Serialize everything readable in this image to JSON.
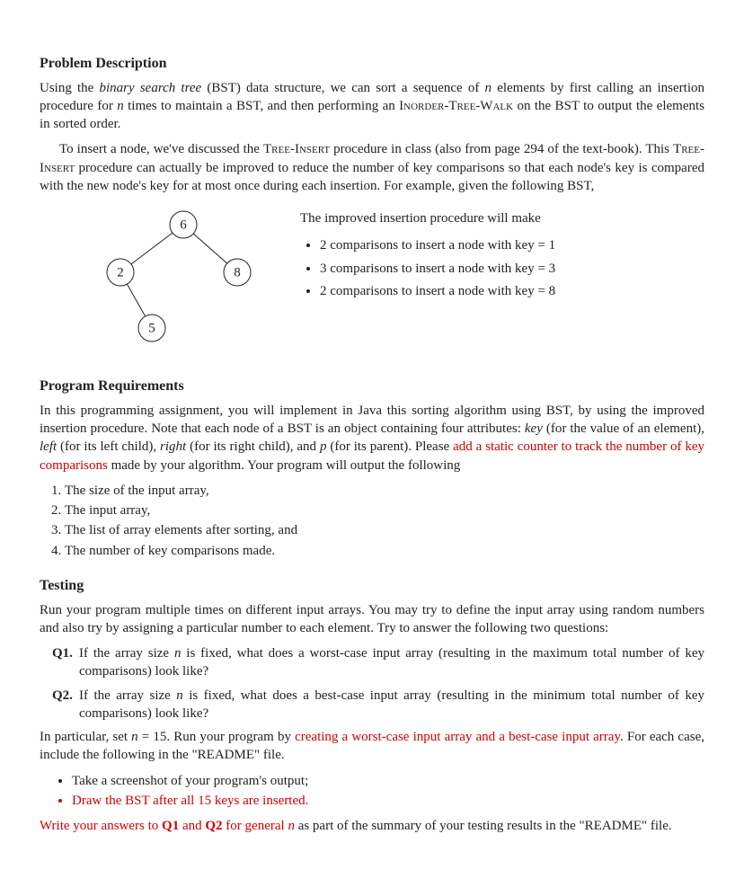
{
  "sections": {
    "desc_title": "Problem Description",
    "reqs_title": "Program Requirements",
    "testing_title": "Testing"
  },
  "desc": {
    "p1_a": "Using the ",
    "p1_b": "binary search tree",
    "p1_c": " (BST) data structure, we can sort a sequence of ",
    "p1_n": "n",
    "p1_d": " elements by first calling an insertion procedure for ",
    "p1_n2": "n",
    "p1_e": " times to maintain a BST, and then performing an ",
    "p1_f": "Inorder-Tree-Walk",
    "p1_g": " on the BST to output the elements in sorted order.",
    "p2_a": "To insert a node, we've discussed the ",
    "p2_b": "Tree-Insert",
    "p2_c": " procedure in class (also from page 294 of the text-book). This ",
    "p2_d": "Tree-Insert",
    "p2_e": " procedure can actually be improved to reduce the number of key comparisons so that each node's key is compared with the new node's key for at most once during each insertion. For example, given the following BST,"
  },
  "bst": {
    "n6": "6",
    "n2": "2",
    "n8": "8",
    "n5": "5",
    "side_intro": "The improved insertion procedure will make",
    "b1": "2 comparisons to insert a node with key = 1",
    "b2": "3 comparisons to insert a node with key = 3",
    "b3": "2 comparisons to insert a node with key = 8"
  },
  "reqs": {
    "p1_a": "In this programming assignment, you will implement in Java this sorting algorithm using BST, by using the improved insertion procedure. Note that each node of a BST is an object containing four attributes: ",
    "key": "key",
    "p1_b": " (for the value of an element), ",
    "left": "left",
    "p1_c": " (for its left child), ",
    "right": "right",
    "p1_d": " (for its right child), and ",
    "p": "p",
    "p1_e": " (for its parent). Please ",
    "red1": "add a static counter to track the number of key comparisons",
    "p1_f": " made by your algorithm. Your program will output the following",
    "li1": "The size of the input array,",
    "li2": "The input array,",
    "li3": "The list of array elements after sorting, and",
    "li4": "The number of key comparisons made."
  },
  "testing": {
    "p1": "Run your program multiple times on different input arrays. You may try to define the input array using random numbers and also try by assigning a particular number to each element. Try to answer the following two questions:",
    "q1_label": "Q1.",
    "q1_a": "If the array size ",
    "q1_n": "n",
    "q1_b": " is fixed, what does a worst-case input array (resulting in the maximum total number of key comparisons) look like?",
    "q2_label": "Q2.",
    "q2_a": "If the array size ",
    "q2_n": "n",
    "q2_b": " is fixed, what does a best-case input array (resulting in the minimum total number of key comparisons) look like?",
    "p2_a": "In particular, set ",
    "p2_n": "n",
    "p2_b": " = 15. Run your program by ",
    "p2_red": "creating a worst-case input array and a best-case input array",
    "p2_c": ". For each case, include the following in the \"README\" file.",
    "b1": "Take a screenshot of your program's output;",
    "b2_red": "Draw the BST after all 15 keys are inserted.",
    "p3_red_a": "Write your answers to ",
    "p3_q1": "Q1",
    "p3_mid": " and ",
    "p3_q2": "Q2",
    "p3_red_b": " for general ",
    "p3_n": "n",
    "p3_c": " as part of the summary of your testing results in the \"README\" file."
  }
}
